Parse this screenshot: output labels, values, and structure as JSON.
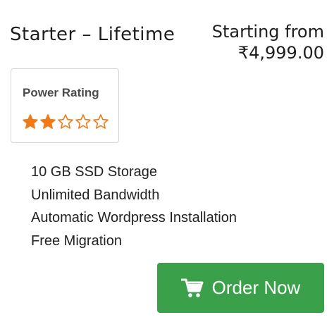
{
  "plan": {
    "title": "Starter – Lifetime",
    "price_prefix": "Starting from",
    "price": "₹4,999.00"
  },
  "rating": {
    "label": "Power Rating",
    "value": 2,
    "max": 5,
    "color": "#f07a1a"
  },
  "features": [
    "10 GB SSD Storage",
    "Unlimited Bandwidth",
    "Automatic Wordpress Installation",
    "Free Migration"
  ],
  "order": {
    "label": "Order Now",
    "icon": "shopping-cart-icon",
    "background": "#3aa14a"
  }
}
